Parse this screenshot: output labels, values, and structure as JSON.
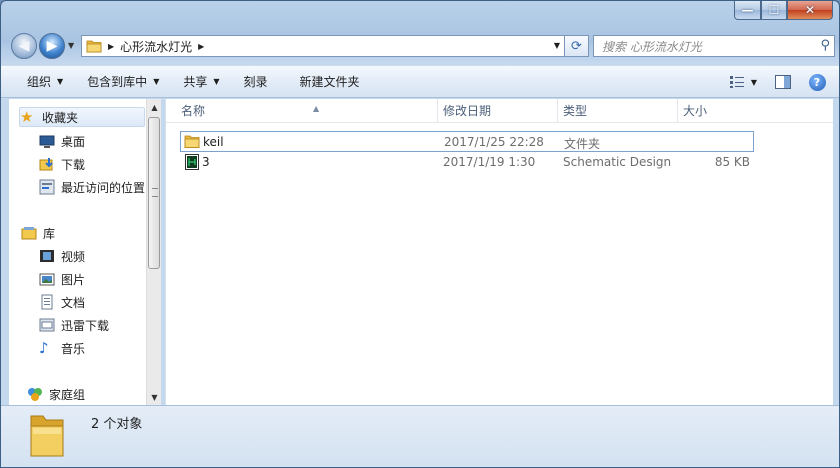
{
  "window": {
    "buttons": {
      "minimize": "—",
      "maximize": "☐",
      "close": "✕"
    }
  },
  "address": {
    "breadcrumb": "心形流水灯光"
  },
  "search": {
    "placeholder": "搜索 心形流水灯光"
  },
  "toolbar": {
    "organize": "组织",
    "include_in_library": "包含到库中",
    "share": "共享",
    "burn": "刻录",
    "new_folder": "新建文件夹"
  },
  "sidebar": {
    "favorites": {
      "label": "收藏夹",
      "items": [
        {
          "label": "桌面",
          "icon": "desktop-icon"
        },
        {
          "label": "下载",
          "icon": "downloads-icon"
        },
        {
          "label": "最近访问的位置",
          "icon": "recent-places-icon"
        }
      ]
    },
    "libraries": {
      "label": "库",
      "items": [
        {
          "label": "视频",
          "icon": "videos-icon"
        },
        {
          "label": "图片",
          "icon": "pictures-icon"
        },
        {
          "label": "文档",
          "icon": "documents-icon"
        },
        {
          "label": "迅雷下载",
          "icon": "thunder-downloads-icon"
        },
        {
          "label": "音乐",
          "icon": "music-icon"
        }
      ]
    },
    "homegroup": {
      "label": "家庭组"
    }
  },
  "columns": {
    "name": "名称",
    "date": "修改日期",
    "type": "类型",
    "size": "大小"
  },
  "files": [
    {
      "name": "keil",
      "date": "2017/1/25 22:28",
      "type": "文件夹",
      "size": "",
      "icon": "folder-icon"
    },
    {
      "name": "3",
      "date": "2017/1/19 1:30",
      "type": "Schematic Design",
      "size": "85 KB",
      "icon": "schematic-file-icon"
    }
  ],
  "status": {
    "count": "2 个对象"
  },
  "colors": {
    "accent": "#3a6aa8",
    "selection": "#dde9f7",
    "folder": "#f2c94c"
  }
}
